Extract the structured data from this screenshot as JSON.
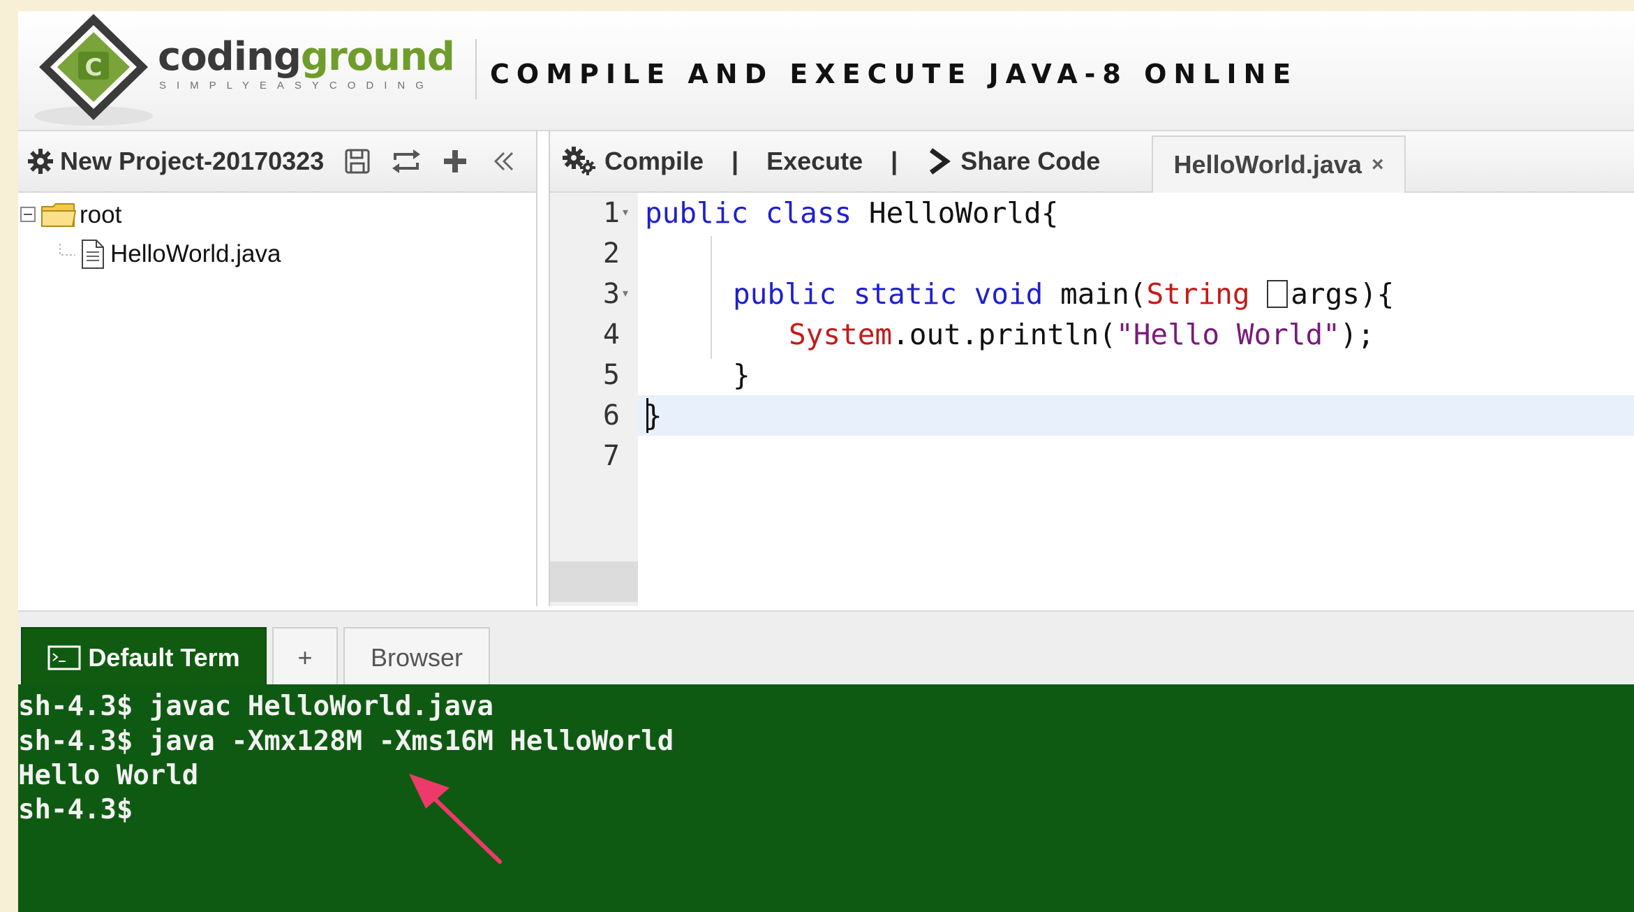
{
  "header": {
    "logo_primary": "coding",
    "logo_secondary": "ground",
    "logo_tagline": "SIMPLYEASYCODING",
    "title": "COMPILE AND EXECUTE JAVA-8 ONLINE"
  },
  "project": {
    "name": "New Project-20170323",
    "tools": [
      "save-icon",
      "refresh-icon",
      "add-icon",
      "collapse-icon"
    ],
    "tree": {
      "root_label": "root",
      "files": [
        "HelloWorld.java"
      ]
    }
  },
  "editor_toolbar": {
    "compile_label": "Compile",
    "separator": "|",
    "execute_label": "Execute",
    "share_label": "Share Code",
    "file_tab_label": "HelloWorld.java",
    "file_tab_close": "×"
  },
  "editor": {
    "line_numbers": [
      "1",
      "2",
      "3",
      "4",
      "5",
      "6",
      "7"
    ],
    "active_line": 7,
    "lines": {
      "l1_kw": "public class",
      "l1_rest": " HelloWorld{",
      "l3_kw": "public static void",
      "l3_main": " main(",
      "l3_type": "String",
      "l3_args": "args){",
      "l4_type": "System",
      "l4_mid": ".out.println(",
      "l4_str": "\"Hello World\"",
      "l4_end": ");",
      "l5": "}",
      "l6": "}"
    }
  },
  "terminal": {
    "tabs": {
      "default_label": "Default Term",
      "add_label": "+",
      "browser_label": "Browser"
    },
    "lines": [
      "sh-4.3$ javac HelloWorld.java",
      "sh-4.3$ java -Xmx128M -Xms16M HelloWorld",
      "Hello World",
      "sh-4.3$"
    ]
  },
  "colors": {
    "page_bg": "#f7efd6",
    "terminal_bg": "#0f5a12",
    "keyword": "#1f1fcf",
    "type": "#c41a1a",
    "string": "#7a1a7a",
    "brand_green": "#6f9d2b",
    "annotation_arrow": "#ee3a6a"
  }
}
